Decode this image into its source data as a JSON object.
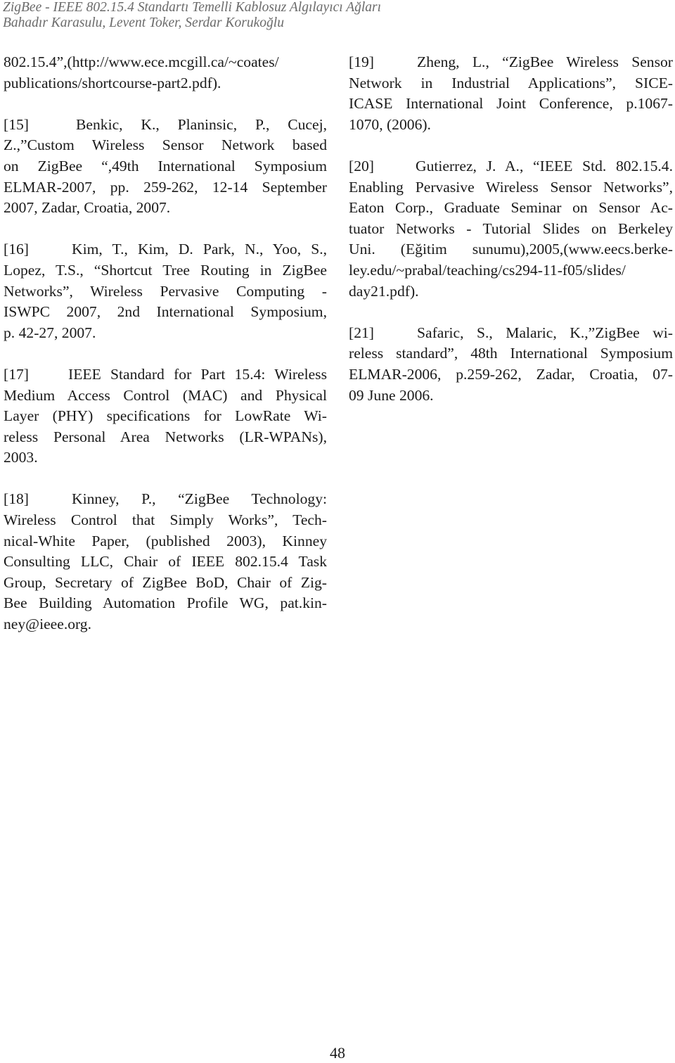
{
  "header": {
    "title": "ZigBee - IEEE 802.15.4 Standartı Temelli Kablosuz Algılayıcı Ağları",
    "authors": "Bahadır Karasulu, Levent Toker, Serdar Korukoğlu"
  },
  "left_column": {
    "continued": {
      "lines": [
        "802.15.4”,(http://www.ece.mcgill.ca/~coates/",
        "publications/shortcourse-part2.pdf)."
      ]
    },
    "references": [
      {
        "number": "[15]",
        "lines": [
          "Benkic, K., Planinsic, P., Cucej,",
          "Z.,”Custom Wireless Sensor Network based",
          "on ZigBee “,49th International Symposium",
          "ELMAR-2007, pp. 259-262, 12-14 September",
          "2007, Zadar, Croatia, 2007."
        ]
      },
      {
        "number": "[16]",
        "lines": [
          "Kim, T., Kim, D. Park, N., Yoo, S.,",
          "Lopez, T.S., “Shortcut Tree Routing in ZigBee",
          "Networks”, Wireless Pervasive Computing -",
          "ISWPC 2007, 2nd International Symposium,",
          "p. 42-27, 2007."
        ]
      },
      {
        "number": "[17]",
        "lines": [
          "IEEE Standard for Part 15.4: Wireless",
          "Medium Access Control (MAC) and Physical",
          "Layer (PHY) specifications for LowRate Wi-",
          "reless Personal Area Networks (LR-WPANs),",
          "2003."
        ]
      },
      {
        "number": "[18]",
        "lines": [
          "Kinney, P., “ZigBee Technology:",
          "Wireless Control that Simply Works”, Tech-",
          "nical-White Paper, (published 2003), Kinney",
          "Consulting LLC, Chair of IEEE 802.15.4 Task",
          "Group, Secretary of ZigBee BoD, Chair of Zig-",
          "Bee Building Automation Profile WG, pat.kin-",
          "ney@ieee.org."
        ]
      }
    ]
  },
  "right_column": {
    "references": [
      {
        "number": "[19]",
        "lines": [
          "Zheng, L., “ZigBee Wireless Sensor",
          "Network in Industrial Applications”, SICE-",
          "ICASE International Joint Conference, p.1067-",
          "1070, (2006)."
        ]
      },
      {
        "number": "[20]",
        "lines": [
          "Gutierrez, J. A., “IEEE Std. 802.15.4.",
          "Enabling Pervasive Wireless Sensor Networks”,",
          "Eaton Corp., Graduate Seminar on Sensor Ac-",
          "tuator Networks - Tutorial Slides on Berkeley",
          "Uni. (Eğitim sunumu),2005,(www.eecs.berke-",
          "ley.edu/~prabal/teaching/cs294-11-f05/slides/",
          "day21.pdf)."
        ]
      },
      {
        "number": "[21]",
        "lines": [
          "Safaric, S., Malaric, K.,”ZigBee wi-",
          "reless standard”, 48th International Symposium",
          "ELMAR-2006, p.259-262, Zadar, Croatia, 07-",
          "09 June 2006."
        ]
      }
    ]
  },
  "footer": {
    "page_number": "48"
  },
  "colors": {
    "header_text": "#6b6b6b",
    "body_text": "#1a1a1a",
    "background": "#ffffff"
  }
}
